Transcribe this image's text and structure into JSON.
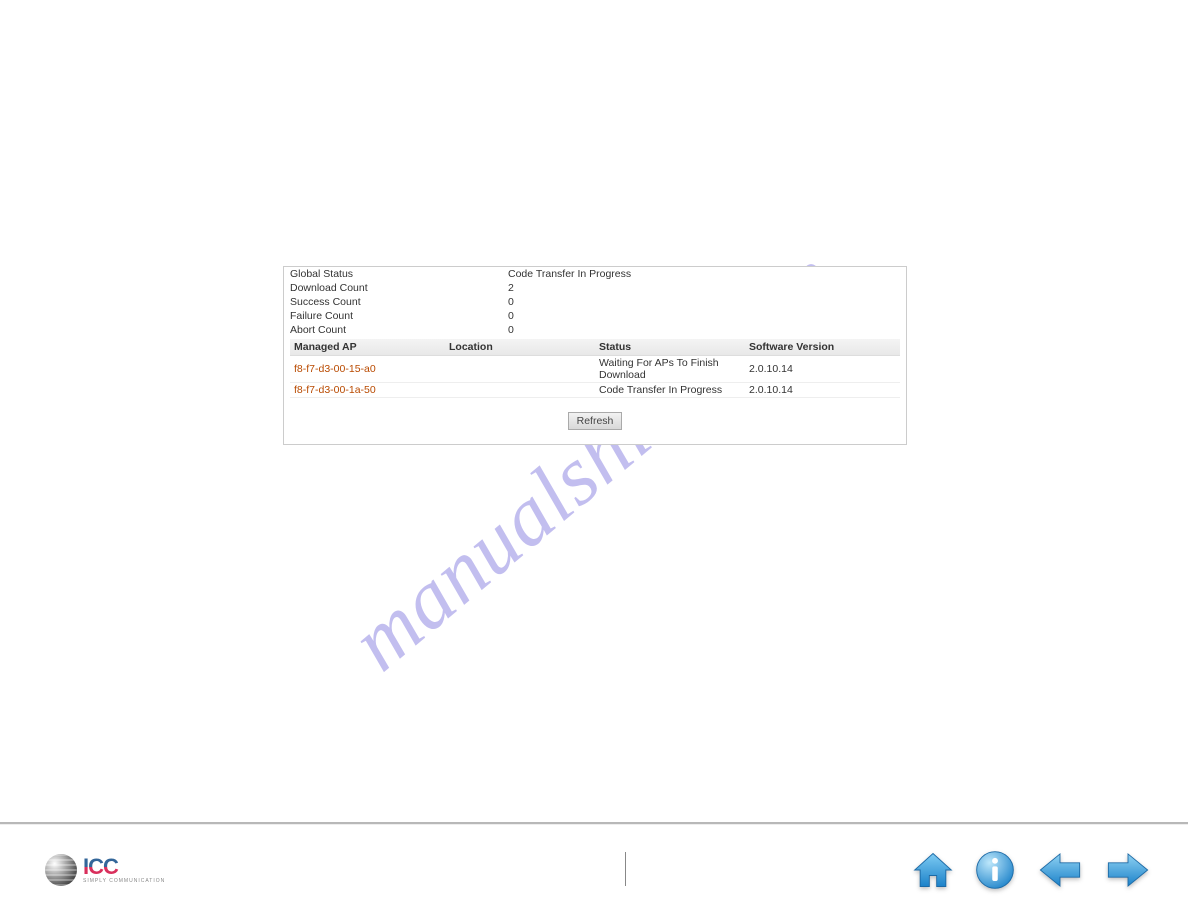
{
  "watermark": "manualshive.com",
  "status_rows": [
    {
      "label": "Global Status",
      "value": "Code Transfer In Progress"
    },
    {
      "label": "Download Count",
      "value": "2"
    },
    {
      "label": "Success Count",
      "value": "0"
    },
    {
      "label": "Failure Count",
      "value": "0"
    },
    {
      "label": "Abort Count",
      "value": "0"
    }
  ],
  "table": {
    "headers": {
      "ap": "Managed AP",
      "location": "Location",
      "status": "Status",
      "version": "Software Version"
    },
    "rows": [
      {
        "ap": "f8-f7-d3-00-15-a0",
        "location": "",
        "status": "Waiting For APs To Finish Download",
        "version": "2.0.10.14"
      },
      {
        "ap": "f8-f7-d3-00-1a-50",
        "location": "",
        "status": "Code Transfer In Progress",
        "version": "2.0.10.14"
      }
    ]
  },
  "buttons": {
    "refresh": "Refresh"
  },
  "footer": {
    "logo_text": "ICC",
    "logo_sub": "SIMPLY COMMUNICATION"
  }
}
